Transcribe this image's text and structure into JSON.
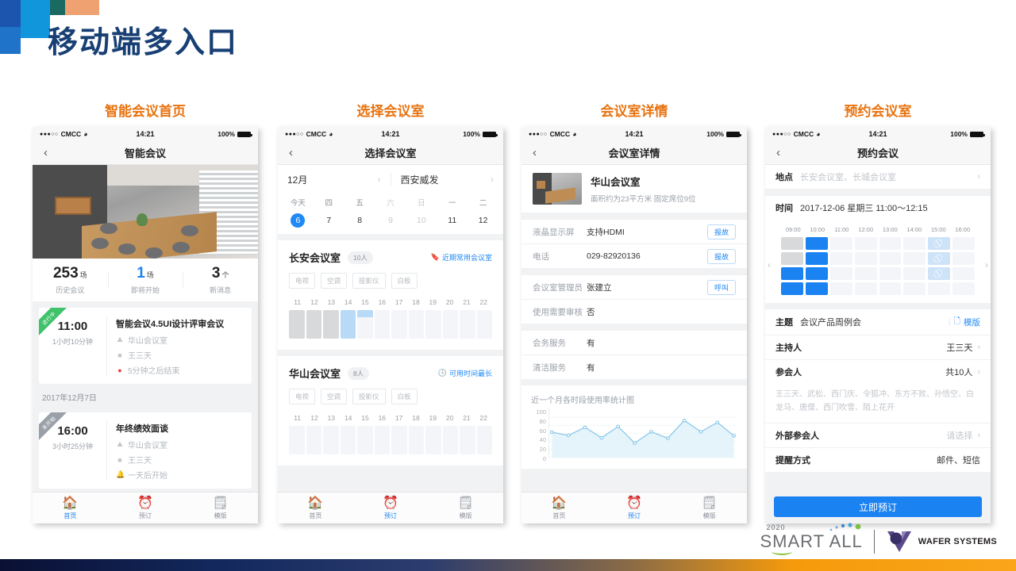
{
  "slide": {
    "title": "移动端多入口"
  },
  "columns": [
    {
      "title": "智能会议首页"
    },
    {
      "title": "选择会议室"
    },
    {
      "title": "会议室详情"
    },
    {
      "title": "预约会议室"
    }
  ],
  "status_bar": {
    "carrier": "CMCC",
    "dots": "●●●○○",
    "wifi": "wifi-icon",
    "time": "14:21",
    "battery": "100%"
  },
  "tabbar": {
    "home": {
      "label": "首页",
      "icon": "home-icon"
    },
    "book": {
      "label": "预订",
      "icon": "alarm-clock-icon"
    },
    "template": {
      "label": "模版",
      "icon": "list-document-icon"
    }
  },
  "phone1": {
    "nav_title": "智能会议",
    "back": "‹",
    "hero_alt": "meeting-room-photo",
    "stats": [
      {
        "num": "253",
        "unit": "场",
        "label": "历史会议",
        "accent": false
      },
      {
        "num": "1",
        "unit": "场",
        "label": "即将开始",
        "accent": true
      },
      {
        "num": "3",
        "unit": "个",
        "label": "新消息",
        "accent": false
      }
    ],
    "meetings": [
      {
        "ribbon": "进行中",
        "ribbon_color": "green",
        "time": "11:00",
        "duration": "1小时10分钟",
        "title": "智能会议4.5UI设计评审会议",
        "room": "华山会议室",
        "host": "王三天",
        "status": "5分钟之后结束",
        "status_type": "alert"
      },
      {
        "ribbon": "未开始",
        "ribbon_color": "gray",
        "time": "16:00",
        "duration": "3小时25分钟",
        "title": "年终绩效面谈",
        "room": "华山会议室",
        "host": "王三天",
        "status": "一天后开始",
        "status_type": "soon"
      }
    ],
    "date_separator": "2017年12月7日"
  },
  "phone2": {
    "nav_title": "选择会议室",
    "back": "‹",
    "month": "12月",
    "location": "西安威发",
    "week": [
      {
        "label": "今天",
        "day": "6",
        "state": "selected"
      },
      {
        "label": "四",
        "day": "7",
        "state": "normal"
      },
      {
        "label": "五",
        "day": "8",
        "state": "normal"
      },
      {
        "label": "六",
        "day": "9",
        "state": "muted"
      },
      {
        "label": "日",
        "day": "10",
        "state": "muted"
      },
      {
        "label": "一",
        "day": "11",
        "state": "normal"
      },
      {
        "label": "二",
        "day": "12",
        "state": "normal"
      }
    ],
    "hours": [
      "11",
      "12",
      "13",
      "14",
      "15",
      "16",
      "17",
      "18",
      "19",
      "20",
      "21",
      "22"
    ],
    "rooms": [
      {
        "name": "长安会议室",
        "capacity": "10人",
        "tag": "近期常用会议室",
        "tag_icon": "tag-icon",
        "facilities": [
          "电视",
          "空调",
          "投影仪",
          "白板"
        ],
        "slots": [
          "past",
          "past",
          "past",
          "busy",
          "half",
          "free",
          "free",
          "free",
          "free",
          "free",
          "free",
          "free"
        ]
      },
      {
        "name": "华山会议室",
        "capacity": "8人",
        "tag": "可用时间最长",
        "tag_icon": "clock-icon",
        "facilities": [
          "电视",
          "空调",
          "投影仪",
          "白板"
        ],
        "slots": [
          "free",
          "free",
          "free",
          "free",
          "free",
          "free",
          "free",
          "free",
          "free",
          "free",
          "free",
          "free"
        ]
      }
    ]
  },
  "phone3": {
    "nav_title": "会议室详情",
    "back": "‹",
    "room": {
      "name": "华山会议室",
      "meta": "面积约为23平方米  固定席位9位",
      "thumb_alt": "meeting-room-thumbnail"
    },
    "rows": [
      {
        "key": "液晶显示屏",
        "value": "支持HDMI",
        "button": "报故"
      },
      {
        "key": "电话",
        "value": "029-82920136",
        "button": "报故"
      },
      {
        "key": "会议室管理员",
        "value": "张建立",
        "button": "呼叫"
      },
      {
        "key": "使用需要审核",
        "value": "否",
        "button": ""
      },
      {
        "key": "会务服务",
        "value": "有",
        "button": ""
      },
      {
        "key": "清洁服务",
        "value": "有",
        "button": ""
      }
    ],
    "chart_data": {
      "type": "area",
      "title": "近一个月各时段使用率统计图",
      "xlabel": "",
      "ylabel": "",
      "x": [
        1,
        2,
        3,
        4,
        5,
        6,
        7,
        8,
        9,
        10,
        11,
        12
      ],
      "values": [
        63,
        55,
        75,
        49,
        77,
        36,
        64,
        48,
        92,
        64,
        87,
        54
      ],
      "yticks": [
        "100",
        "80",
        "60",
        "40",
        "20",
        "0"
      ],
      "ylim": [
        0,
        110
      ],
      "grid": true,
      "legend": "none",
      "line_color": "#7fc4e8",
      "fill_color": "#dcf0fa"
    }
  },
  "phone4": {
    "nav_title": "预约会议",
    "back": "‹",
    "place": {
      "key": "地点",
      "value": "长安会议室、长城会议室"
    },
    "time": {
      "key": "时间",
      "value": "2017-12-06  星期三  11:00～12:15"
    },
    "hours": [
      "09:00",
      "10:00",
      "11:00",
      "12:00",
      "13:00",
      "14:00",
      "15:00",
      "16:00"
    ],
    "grid": [
      [
        "past",
        "sel",
        "free",
        "free",
        "free",
        "free",
        "dis",
        "free"
      ],
      [
        "past",
        "sel",
        "free",
        "free",
        "free",
        "free",
        "dis",
        "free"
      ],
      [
        "sel",
        "sel",
        "free",
        "free",
        "free",
        "free",
        "dis",
        "free"
      ],
      [
        "sel",
        "sel",
        "free",
        "free",
        "free",
        "free",
        "free",
        "free"
      ]
    ],
    "subject": {
      "key": "主题",
      "value": "会议产品周例会",
      "template": "模版",
      "template_icon": "copy-icon"
    },
    "host": {
      "key": "主持人",
      "value": "王三天"
    },
    "attendees_count": {
      "key": "参会人",
      "value": "共10人"
    },
    "attendees_list": "王三天、武松、西门庆、令狐冲、东方不败、孙悟空、白龙马、唐僧、西门吹雪、陌上花开",
    "external": {
      "key": "外部参会人",
      "value": "请选择"
    },
    "remind": {
      "key": "提醒方式",
      "value": "邮件、短信"
    },
    "book_button": "立即预订"
  },
  "footer": {
    "smartall_year": "2020",
    "smartall": "SMART ALL",
    "wafer": "WAFER SYSTEMS"
  },
  "colors": {
    "accent_blue": "#1b82f2",
    "orange": "#e8730f",
    "title_navy": "#173f74"
  }
}
